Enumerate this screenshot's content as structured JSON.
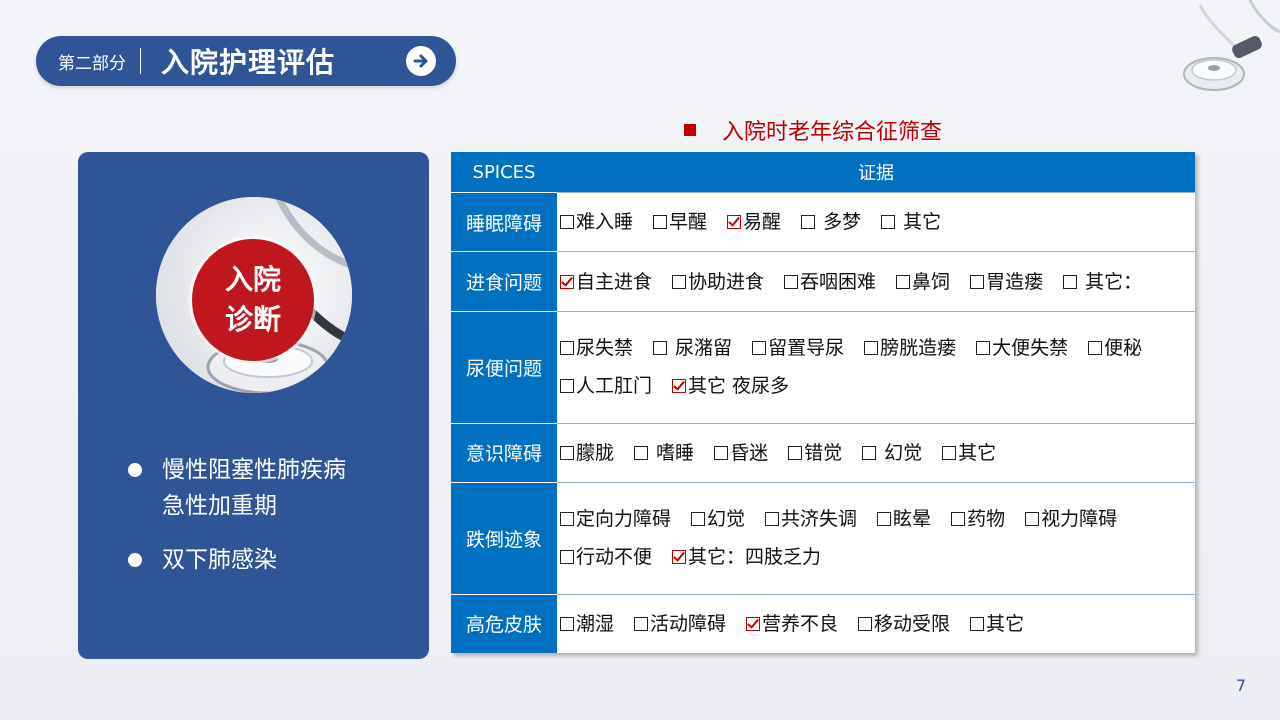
{
  "header": {
    "section": "第二部分",
    "title": "入院护理评估"
  },
  "subtitle": "入院时老年综合征筛查",
  "left_card": {
    "badge_line1": "入院",
    "badge_line2": "诊断",
    "diagnoses": [
      {
        "line1": "慢性阻塞性肺疾病",
        "line2": "急性加重期"
      },
      {
        "line1": "双下肺感染"
      }
    ]
  },
  "table": {
    "headers": [
      "SPICES",
      "证据"
    ],
    "rows": [
      {
        "category": "睡眠障碍",
        "options": [
          {
            "label": "难入睡",
            "checked": false
          },
          {
            "label": "早醒",
            "checked": false
          },
          {
            "label": "易醒",
            "checked": true
          },
          {
            "label": " 多梦",
            "checked": false
          },
          {
            "label": " 其它",
            "checked": false
          }
        ]
      },
      {
        "category": "进食问题",
        "options": [
          {
            "label": "自主进食",
            "checked": true
          },
          {
            "label": "协助进食",
            "checked": false
          },
          {
            "label": "吞咽困难",
            "checked": false
          },
          {
            "label": "鼻饲",
            "checked": false
          },
          {
            "label": "胃造瘘",
            "checked": false
          },
          {
            "label": " 其它：",
            "checked": false
          }
        ]
      },
      {
        "category": "尿便问题",
        "options": [
          {
            "label": "尿失禁",
            "checked": false
          },
          {
            "label": " 尿潴留",
            "checked": false
          },
          {
            "label": "留置导尿",
            "checked": false
          },
          {
            "label": "膀胱造瘘",
            "checked": false
          },
          {
            "label": "大便失禁",
            "checked": false
          },
          {
            "label": "便秘",
            "checked": false
          },
          {
            "label": "人工肛门",
            "checked": false
          },
          {
            "label": "其它 夜尿多",
            "checked": true
          }
        ]
      },
      {
        "category": "意识障碍",
        "options": [
          {
            "label": "朦胧",
            "checked": false
          },
          {
            "label": " 嗜睡",
            "checked": false
          },
          {
            "label": "昏迷",
            "checked": false
          },
          {
            "label": "错觉",
            "checked": false
          },
          {
            "label": " 幻觉",
            "checked": false
          },
          {
            "label": "其它",
            "checked": false
          }
        ]
      },
      {
        "category": "跌倒迹象",
        "options": [
          {
            "label": "定向力障碍",
            "checked": false
          },
          {
            "label": "幻觉",
            "checked": false
          },
          {
            "label": "共济失调",
            "checked": false
          },
          {
            "label": "眩晕",
            "checked": false
          },
          {
            "label": "药物",
            "checked": false
          },
          {
            "label": "视力障碍",
            "checked": false
          },
          {
            "label": "行动不便",
            "checked": false
          },
          {
            "label": "其它：四肢乏力",
            "checked": true
          }
        ]
      },
      {
        "category": "高危皮肤",
        "options": [
          {
            "label": "潮湿",
            "checked": false
          },
          {
            "label": "活动障碍",
            "checked": false
          },
          {
            "label": "营养不良",
            "checked": true
          },
          {
            "label": "移动受限",
            "checked": false
          },
          {
            "label": "其它",
            "checked": false
          }
        ]
      }
    ]
  },
  "page_number": "7",
  "colors": {
    "primary": "#2f5597",
    "table_blue": "#0070c0",
    "accent_red": "#c00000"
  }
}
